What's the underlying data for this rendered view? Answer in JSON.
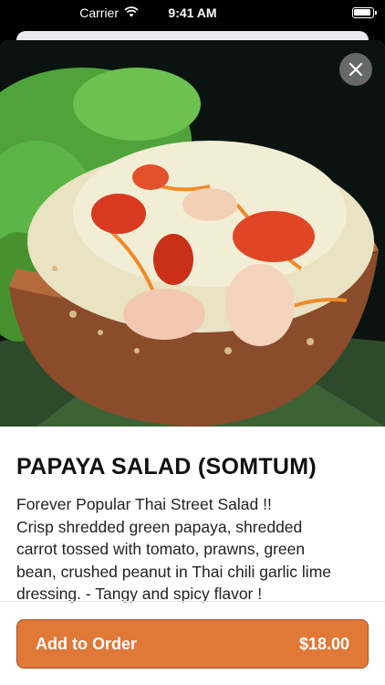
{
  "status_bar": {
    "carrier": "Carrier",
    "time": "9:41 AM"
  },
  "item": {
    "name": "PAPAYA SALAD (SOMTUM)",
    "description_lines": [
      "Forever Popular Thai Street Salad !!",
      "Crisp shredded green papaya, shredded",
      "carrot tossed with tomato, prawns, green",
      "bean, crushed peanut in Thai chili garlic lime",
      "dressing. - Tangy and spicy flavor !"
    ]
  },
  "footer": {
    "add_label": "Add to Order",
    "price": "$18.00"
  },
  "icons": {
    "close": "close-icon",
    "wifi": "wifi-icon",
    "battery": "battery-icon"
  },
  "colors": {
    "accent": "#e07838"
  }
}
